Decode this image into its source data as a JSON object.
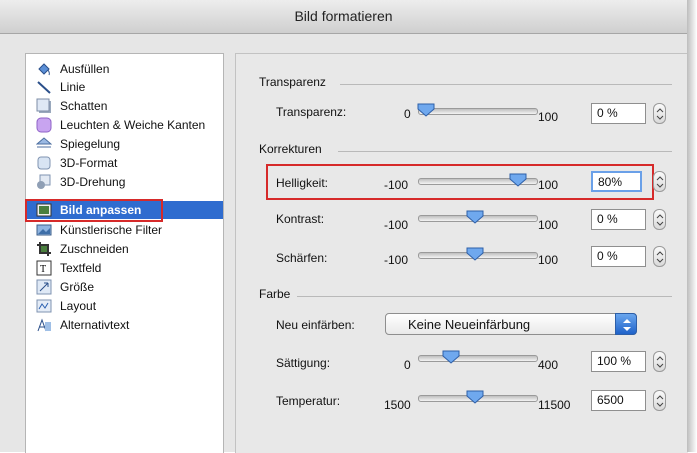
{
  "window": {
    "title": "Bild formatieren"
  },
  "sidebar": {
    "items": [
      {
        "label": "Ausfüllen",
        "icon": "paint-bucket-icon"
      },
      {
        "label": "Linie",
        "icon": "line-icon"
      },
      {
        "label": "Schatten",
        "icon": "shadow-icon"
      },
      {
        "label": "Leuchten & Weiche Kanten",
        "icon": "glow-icon"
      },
      {
        "label": "Spiegelung",
        "icon": "reflection-icon"
      },
      {
        "label": "3D-Format",
        "icon": "3d-format-icon"
      },
      {
        "label": "3D-Drehung",
        "icon": "3d-rotation-icon"
      },
      {
        "label": "Bild anpassen",
        "icon": "adjust-picture-icon",
        "selected": true
      },
      {
        "label": "Künstlerische Filter",
        "icon": "artistic-filter-icon"
      },
      {
        "label": "Zuschneiden",
        "icon": "crop-icon"
      },
      {
        "label": "Textfeld",
        "icon": "textbox-icon"
      },
      {
        "label": "Größe",
        "icon": "size-icon"
      },
      {
        "label": "Layout",
        "icon": "layout-icon"
      },
      {
        "label": "Alternativtext",
        "icon": "alt-text-icon"
      }
    ]
  },
  "transparency": {
    "section": "Transparenz",
    "label": "Transparenz:",
    "min": "0",
    "max": "100",
    "value": "0 %",
    "level": 0
  },
  "corrections": {
    "section": "Korrekturen",
    "brightness": {
      "label": "Helligkeit:",
      "min": "-100",
      "max": "100",
      "value": "80",
      "unit": "%",
      "level": 0.9
    },
    "contrast": {
      "label": "Kontrast:",
      "min": "-100",
      "max": "100",
      "value": "0 %",
      "level": 0.5
    },
    "sharpness": {
      "label": "Schärfen:",
      "min": "-100",
      "max": "100",
      "value": "0 %",
      "level": 0.5
    }
  },
  "color": {
    "section": "Farbe",
    "recolor": {
      "label": "Neu einfärben:",
      "selected": "Keine Neueinfärbung"
    },
    "saturation": {
      "label": "Sättigung:",
      "min": "0",
      "max": "400",
      "value": "100 %",
      "level": 0.25
    },
    "temperature": {
      "label": "Temperatur:",
      "min": "1500",
      "max": "11500",
      "value": "6500",
      "level": 0.5
    }
  },
  "colors": {
    "selection": "#2f6ccf",
    "highlight": "#d62a2a",
    "thumb": "#6fa8ee"
  }
}
